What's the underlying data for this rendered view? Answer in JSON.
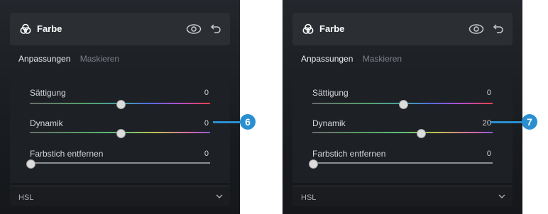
{
  "panels": [
    {
      "header": {
        "title": "Farbe"
      },
      "tabs": {
        "active": "Anpassungen",
        "inactive": "Maskieren"
      },
      "sliders": [
        {
          "label": "Sättigung",
          "value": "0",
          "level": 0.5
        },
        {
          "label": "Dynamik",
          "value": "0",
          "level": 0.5
        },
        {
          "label": "Farbstich entfernen",
          "value": "0",
          "level": 0.0
        }
      ],
      "section": {
        "label": "HSL"
      }
    },
    {
      "header": {
        "title": "Farbe"
      },
      "tabs": {
        "active": "Anpassungen",
        "inactive": "Maskieren"
      },
      "sliders": [
        {
          "label": "Sättigung",
          "value": "0",
          "level": 0.5
        },
        {
          "label": "Dynamik",
          "value": "20",
          "level": 0.6
        },
        {
          "label": "Farbstich entfernen",
          "value": "0",
          "level": 0.0
        }
      ],
      "section": {
        "label": "HSL"
      }
    }
  ],
  "callouts": [
    {
      "label": "6"
    },
    {
      "label": "7"
    }
  ],
  "colors": {
    "accent": "#2a8fd0",
    "panel_bg": "#1b1e22"
  }
}
